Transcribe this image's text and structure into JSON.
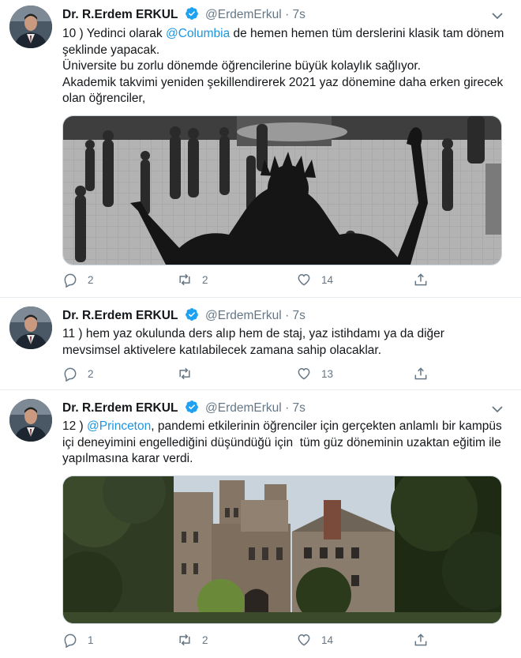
{
  "tweets": [
    {
      "name": "Dr. R.Erdem ERKUL",
      "handle": "@ErdemErkul",
      "dot": "·",
      "time": "7s",
      "text_prefix": "10 ) Yedinci olarak ",
      "mention": "@Columbia",
      "text_suffix": " de hemen hemen tüm derslerini klasik tam dönem şeklinde yapacak.\nÜniversite bu zorlu dönemde öğrencilerine büyük kolaylık sağlıyor.\nAkademik takvimi yeniden şekillendirerek 2021 yaz dönemine daha erken girecek olan öğrenciler,",
      "reply_count": "2",
      "retweet_count": "2",
      "like_count": "14"
    },
    {
      "name": "Dr. R.Erdem ERKUL",
      "handle": "@ErdemErkul",
      "dot": "·",
      "time": "7s",
      "text": "11 ) hem yaz okulunda ders alıp hem de staj, yaz istihdamı ya da diğer mevsimsel aktivelere katılabilecek zamana sahip olacaklar.",
      "reply_count": "2",
      "retweet_count": "",
      "like_count": "13"
    },
    {
      "name": "Dr. R.Erdem ERKUL",
      "handle": "@ErdemErkul",
      "dot": "·",
      "time": "7s",
      "mention": "@Princeton",
      "text_suffix": ", pandemi etkilerinin öğrenciler için gerçekten anlamlı bir kampüs içi deneyimini engellediğini düşündüğü için  tüm güz döneminin uzaktan eğitim ile yapılmasına karar verdi.",
      "text_prefix": "12 ) ",
      "reply_count": "1",
      "retweet_count": "2",
      "like_count": "14"
    }
  ],
  "colors": {
    "link": "#1b95e0",
    "verified": "#1da1f2",
    "muted": "#657786"
  }
}
